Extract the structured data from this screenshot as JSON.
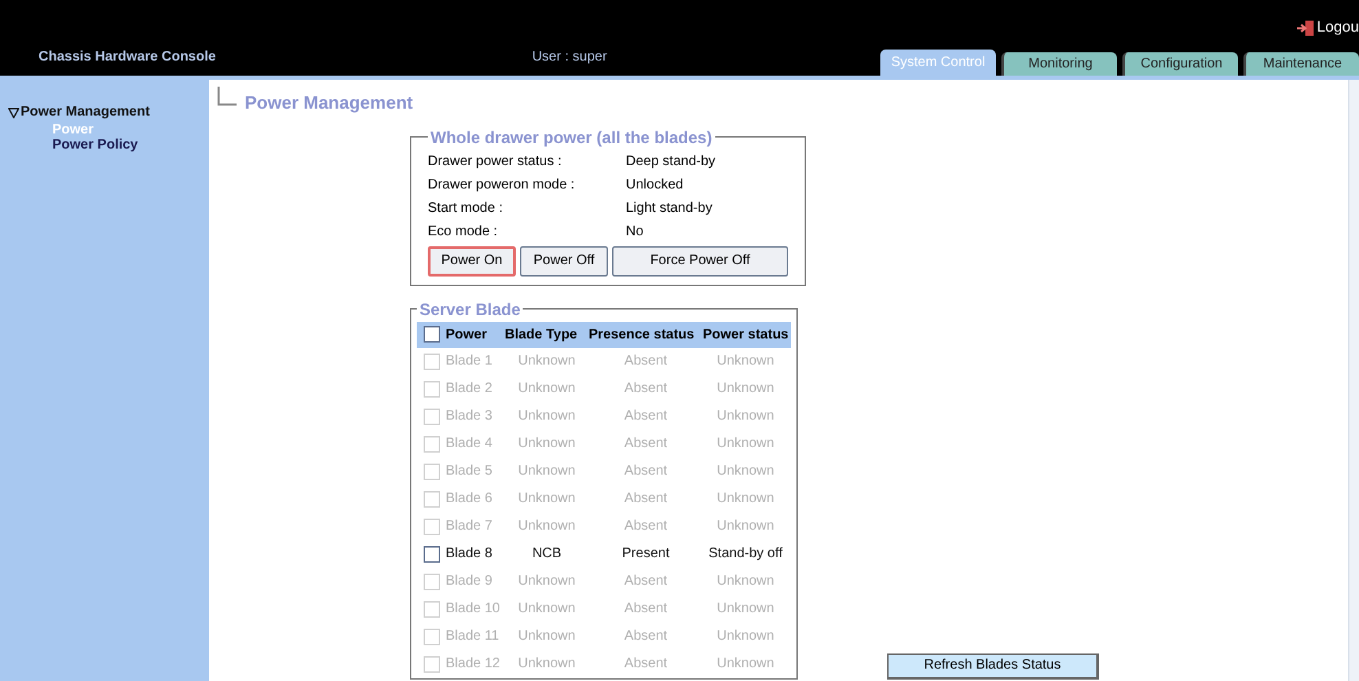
{
  "header": {
    "title": "Chassis Hardware Console",
    "user": "User : super",
    "logout": "Logou"
  },
  "tabs": [
    {
      "label": "System Control",
      "selected": true
    },
    {
      "label": "Monitoring",
      "selected": false
    },
    {
      "label": "Configuration",
      "selected": false
    },
    {
      "label": "Maintenance",
      "selected": false
    }
  ],
  "sidebar": {
    "group": {
      "label": "Power Management",
      "expanded": true,
      "children": [
        {
          "label": "Power",
          "selected": true
        },
        {
          "label": "Power Policy",
          "selected": false
        }
      ]
    }
  },
  "page_title": "Power Management",
  "drawer": {
    "legend": "Whole drawer power (all the blades)",
    "fields": [
      {
        "label": "Drawer power status :",
        "value": "Deep stand-by"
      },
      {
        "label": "Drawer poweron mode :",
        "value": "Unlocked"
      },
      {
        "label": "Start mode :",
        "value": "Light stand-by"
      },
      {
        "label": "Eco mode :",
        "value": "No"
      }
    ],
    "buttons": [
      {
        "label": "Power On",
        "focused": true
      },
      {
        "label": "Power Off",
        "focused": false
      },
      {
        "label": "Force Power Off",
        "focused": false
      }
    ]
  },
  "blades": {
    "legend": "Server Blade",
    "select_all_checked": false,
    "columns": [
      "Power",
      "Blade Type",
      "Presence status",
      "Power status"
    ],
    "rows": [
      {
        "name": "Blade 1",
        "type": "Unknown",
        "presence": "Absent",
        "power": "Unknown",
        "disabled": true,
        "checked": false
      },
      {
        "name": "Blade 2",
        "type": "Unknown",
        "presence": "Absent",
        "power": "Unknown",
        "disabled": true,
        "checked": false
      },
      {
        "name": "Blade 3",
        "type": "Unknown",
        "presence": "Absent",
        "power": "Unknown",
        "disabled": true,
        "checked": false
      },
      {
        "name": "Blade 4",
        "type": "Unknown",
        "presence": "Absent",
        "power": "Unknown",
        "disabled": true,
        "checked": false
      },
      {
        "name": "Blade 5",
        "type": "Unknown",
        "presence": "Absent",
        "power": "Unknown",
        "disabled": true,
        "checked": false
      },
      {
        "name": "Blade 6",
        "type": "Unknown",
        "presence": "Absent",
        "power": "Unknown",
        "disabled": true,
        "checked": false
      },
      {
        "name": "Blade 7",
        "type": "Unknown",
        "presence": "Absent",
        "power": "Unknown",
        "disabled": true,
        "checked": false
      },
      {
        "name": "Blade 8",
        "type": "NCB",
        "presence": "Present",
        "power": "Stand-by off",
        "disabled": false,
        "checked": false
      },
      {
        "name": "Blade 9",
        "type": "Unknown",
        "presence": "Absent",
        "power": "Unknown",
        "disabled": true,
        "checked": false
      },
      {
        "name": "Blade 10",
        "type": "Unknown",
        "presence": "Absent",
        "power": "Unknown",
        "disabled": true,
        "checked": false
      },
      {
        "name": "Blade 11",
        "type": "Unknown",
        "presence": "Absent",
        "power": "Unknown",
        "disabled": true,
        "checked": false
      },
      {
        "name": "Blade 12",
        "type": "Unknown",
        "presence": "Absent",
        "power": "Unknown",
        "disabled": true,
        "checked": false
      }
    ]
  },
  "refresh_button": "Refresh Blades Status"
}
